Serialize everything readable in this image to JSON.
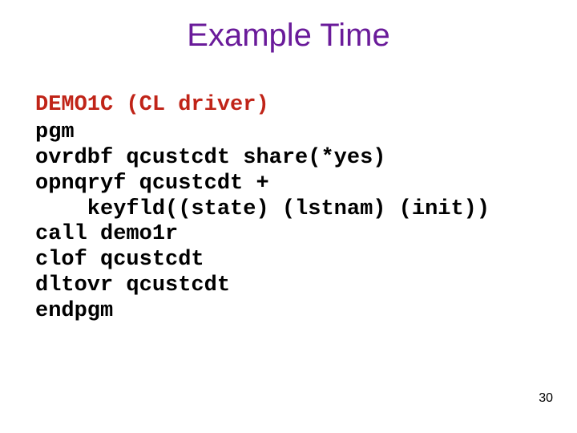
{
  "slide": {
    "title": "Example Time",
    "subhead": "DEMO1C (CL driver)",
    "code": "pgm\novrdbf qcustcdt share(*yes)\nopnqryf qcustcdt +\n    keyfld((state) (lstnam) (init))\ncall demo1r\nclof qcustcdt\ndltovr qcustcdt\nendpgm",
    "page_number": "30"
  }
}
